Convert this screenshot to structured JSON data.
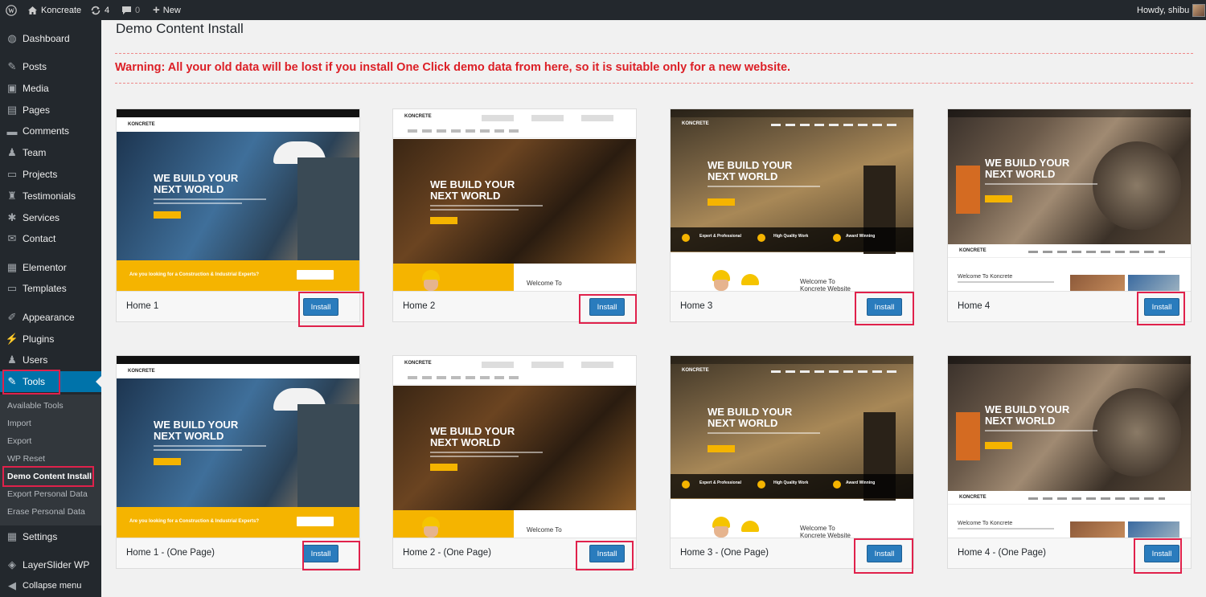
{
  "admin_bar": {
    "site_name": "Koncreate",
    "updates_count": "4",
    "comments_count": "0",
    "new_label": "New",
    "greeting": "Howdy, shibu"
  },
  "sidebar": {
    "items": [
      {
        "label": "Dashboard",
        "icon": "dashboard-icon"
      },
      {
        "label": "Posts",
        "icon": "pin-icon"
      },
      {
        "label": "Media",
        "icon": "media-icon"
      },
      {
        "label": "Pages",
        "icon": "pages-icon"
      },
      {
        "label": "Comments",
        "icon": "comment-icon"
      },
      {
        "label": "Team",
        "icon": "team-icon"
      },
      {
        "label": "Projects",
        "icon": "folder-icon"
      },
      {
        "label": "Testimonials",
        "icon": "testimonial-icon"
      },
      {
        "label": "Services",
        "icon": "services-icon"
      },
      {
        "label": "Contact",
        "icon": "mail-icon"
      },
      {
        "label": "Elementor",
        "icon": "elementor-icon"
      },
      {
        "label": "Templates",
        "icon": "folder-icon"
      },
      {
        "label": "Appearance",
        "icon": "brush-icon"
      },
      {
        "label": "Plugins",
        "icon": "plugin-icon"
      },
      {
        "label": "Users",
        "icon": "user-icon"
      },
      {
        "label": "Tools",
        "icon": "wrench-icon"
      },
      {
        "label": "Settings",
        "icon": "settings-icon"
      },
      {
        "label": "LayerSlider WP",
        "icon": "layers-icon"
      },
      {
        "label": "Collapse menu",
        "icon": "collapse-icon"
      }
    ],
    "tools_submenu": [
      "Available Tools",
      "Import",
      "Export",
      "WP Reset",
      "Demo Content Install",
      "Export Personal Data",
      "Erase Personal Data"
    ]
  },
  "main": {
    "title": "Demo Content Install",
    "warning": "Warning: All your old data will be lost if you install One Click demo data from here, so it is suitable only for a new website.",
    "install_label": "Install",
    "demos": [
      {
        "name": "Home 1",
        "style": 1
      },
      {
        "name": "Home 2",
        "style": 2
      },
      {
        "name": "Home 3",
        "style": 3
      },
      {
        "name": "Home 4",
        "style": 4
      },
      {
        "name": "Home 1 - (One Page)",
        "style": 1
      },
      {
        "name": "Home 2 - (One Page)",
        "style": 2
      },
      {
        "name": "Home 3 - (One Page)",
        "style": 3
      },
      {
        "name": "Home 4 - (One Page)",
        "style": 4
      }
    ],
    "thumbnail_text": {
      "logo": "KONCRETE",
      "headline_1": "WE BUILD YOUR",
      "headline_2": "NEXT WORLD",
      "banner": "Are you looking for a Construction & Industrial Experts?",
      "welcome_1": "Welcome To",
      "welcome_2": "Koncrete Website",
      "welcome_short": "Welcome To Koncrete",
      "feature_1": "Expert & Professional",
      "feature_2": "High Quality Work",
      "feature_3": "Award Winning"
    }
  },
  "colors": {
    "admin_bg": "#23282d",
    "active_menu": "#0073aa",
    "warning": "#dc1f26",
    "install_button": "#2a7cbd",
    "highlight": "#e0214b",
    "brand_yellow": "#f5b400"
  }
}
